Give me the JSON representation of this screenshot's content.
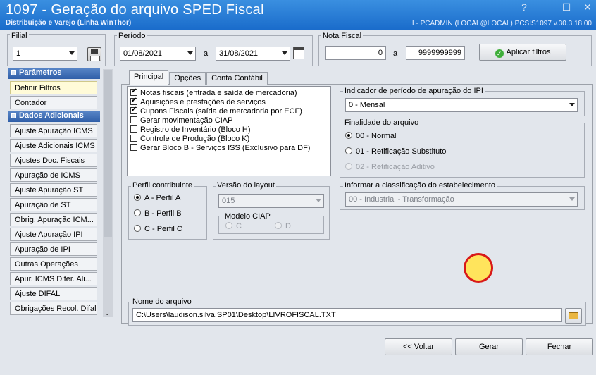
{
  "window": {
    "title": "1097 - Geração do arquivo SPED Fiscal",
    "subtitle": "Distribuição e Varejo (Linha WinThor)",
    "user_info": "I - PCADMIN (LOCAL@LOCAL)   PCSIS1097  v.30.3.18.00",
    "help_glyph": "?",
    "min_glyph": "–",
    "max_glyph": "☐",
    "close_glyph": "✕"
  },
  "filial": {
    "label": "Filial",
    "value": "1"
  },
  "periodo": {
    "label": "Período",
    "start": "01/08/2021",
    "sep": "a",
    "end": "31/08/2021"
  },
  "nota_fiscal": {
    "label": "Nota Fiscal",
    "from": "0",
    "sep": "a",
    "to": "9999999999"
  },
  "apply_button": {
    "label": "Aplicar filtros",
    "icon": "check-circle-icon"
  },
  "sidebar": {
    "section1": "Parâmetros",
    "section1_items": [
      "Definir Filtros",
      "Contador"
    ],
    "section2": "Dados Adicionais",
    "section2_items": [
      "Ajuste Apuração ICMS",
      "Ajuste Adicionais ICMS",
      "Ajustes Doc. Fiscais",
      "Apuração de ICMS",
      "Ajuste Apuração ST",
      "Apuração de ST",
      "Obrig. Apuração ICM...",
      "Ajuste Apuração IPI",
      "Apuração de IPI",
      "Outras Operações",
      "Apur. ICMS Difer. Ali...",
      "Ajuste DIFAL",
      "Obrigações Recol. Difal"
    ]
  },
  "tabs": [
    "Principal",
    "Opções",
    "Conta Contábil"
  ],
  "checklist": [
    {
      "label": "Notas fiscais (entrada e saída de mercadoria)",
      "checked": true
    },
    {
      "label": "Aquisições e prestações de serviços",
      "checked": true
    },
    {
      "label": "Cupons Fiscais (saída de mercadoria por ECF)",
      "checked": true
    },
    {
      "label": "Gerar movimentação CIAP",
      "checked": false
    },
    {
      "label": "Registro de Inventário (Bloco H)",
      "checked": false
    },
    {
      "label": "Controle de Produção (Bloco K)",
      "checked": false
    },
    {
      "label": "Gerar Bloco B - Serviços ISS (Exclusivo para DF)",
      "checked": false
    }
  ],
  "indicador": {
    "label": "Indicador de período de apuração do IPI",
    "value": "0 - Mensal"
  },
  "finalidade": {
    "label": "Finalidade do arquivo",
    "options": [
      {
        "label": "00 - Normal",
        "selected": true,
        "enabled": true
      },
      {
        "label": "01 - Retificação Substituto",
        "selected": false,
        "enabled": true
      },
      {
        "label": "02 - Retificação Aditivo",
        "selected": false,
        "enabled": false
      }
    ]
  },
  "perfil": {
    "label": "Perfil contribuinte",
    "options": [
      {
        "label": "A - Perfil A",
        "selected": true
      },
      {
        "label": "B - Perfil B",
        "selected": false
      },
      {
        "label": "C - Perfil C",
        "selected": false
      }
    ]
  },
  "versao": {
    "label": "Versão do layout",
    "value": "015"
  },
  "modelo_ciap": {
    "label": "Modelo CIAP",
    "options": [
      "C",
      "D"
    ]
  },
  "classificacao": {
    "label": "Informar a classificação do estabelecimento",
    "value": "00 - Industrial - Transformação"
  },
  "arquivo": {
    "label": "Nome do arquivo",
    "value": "C:\\Users\\laudison.silva.SP01\\Desktop\\LIVROFISCAL.TXT"
  },
  "footer": {
    "voltar": "<< Voltar",
    "gerar": "Gerar",
    "fechar": "Fechar"
  }
}
